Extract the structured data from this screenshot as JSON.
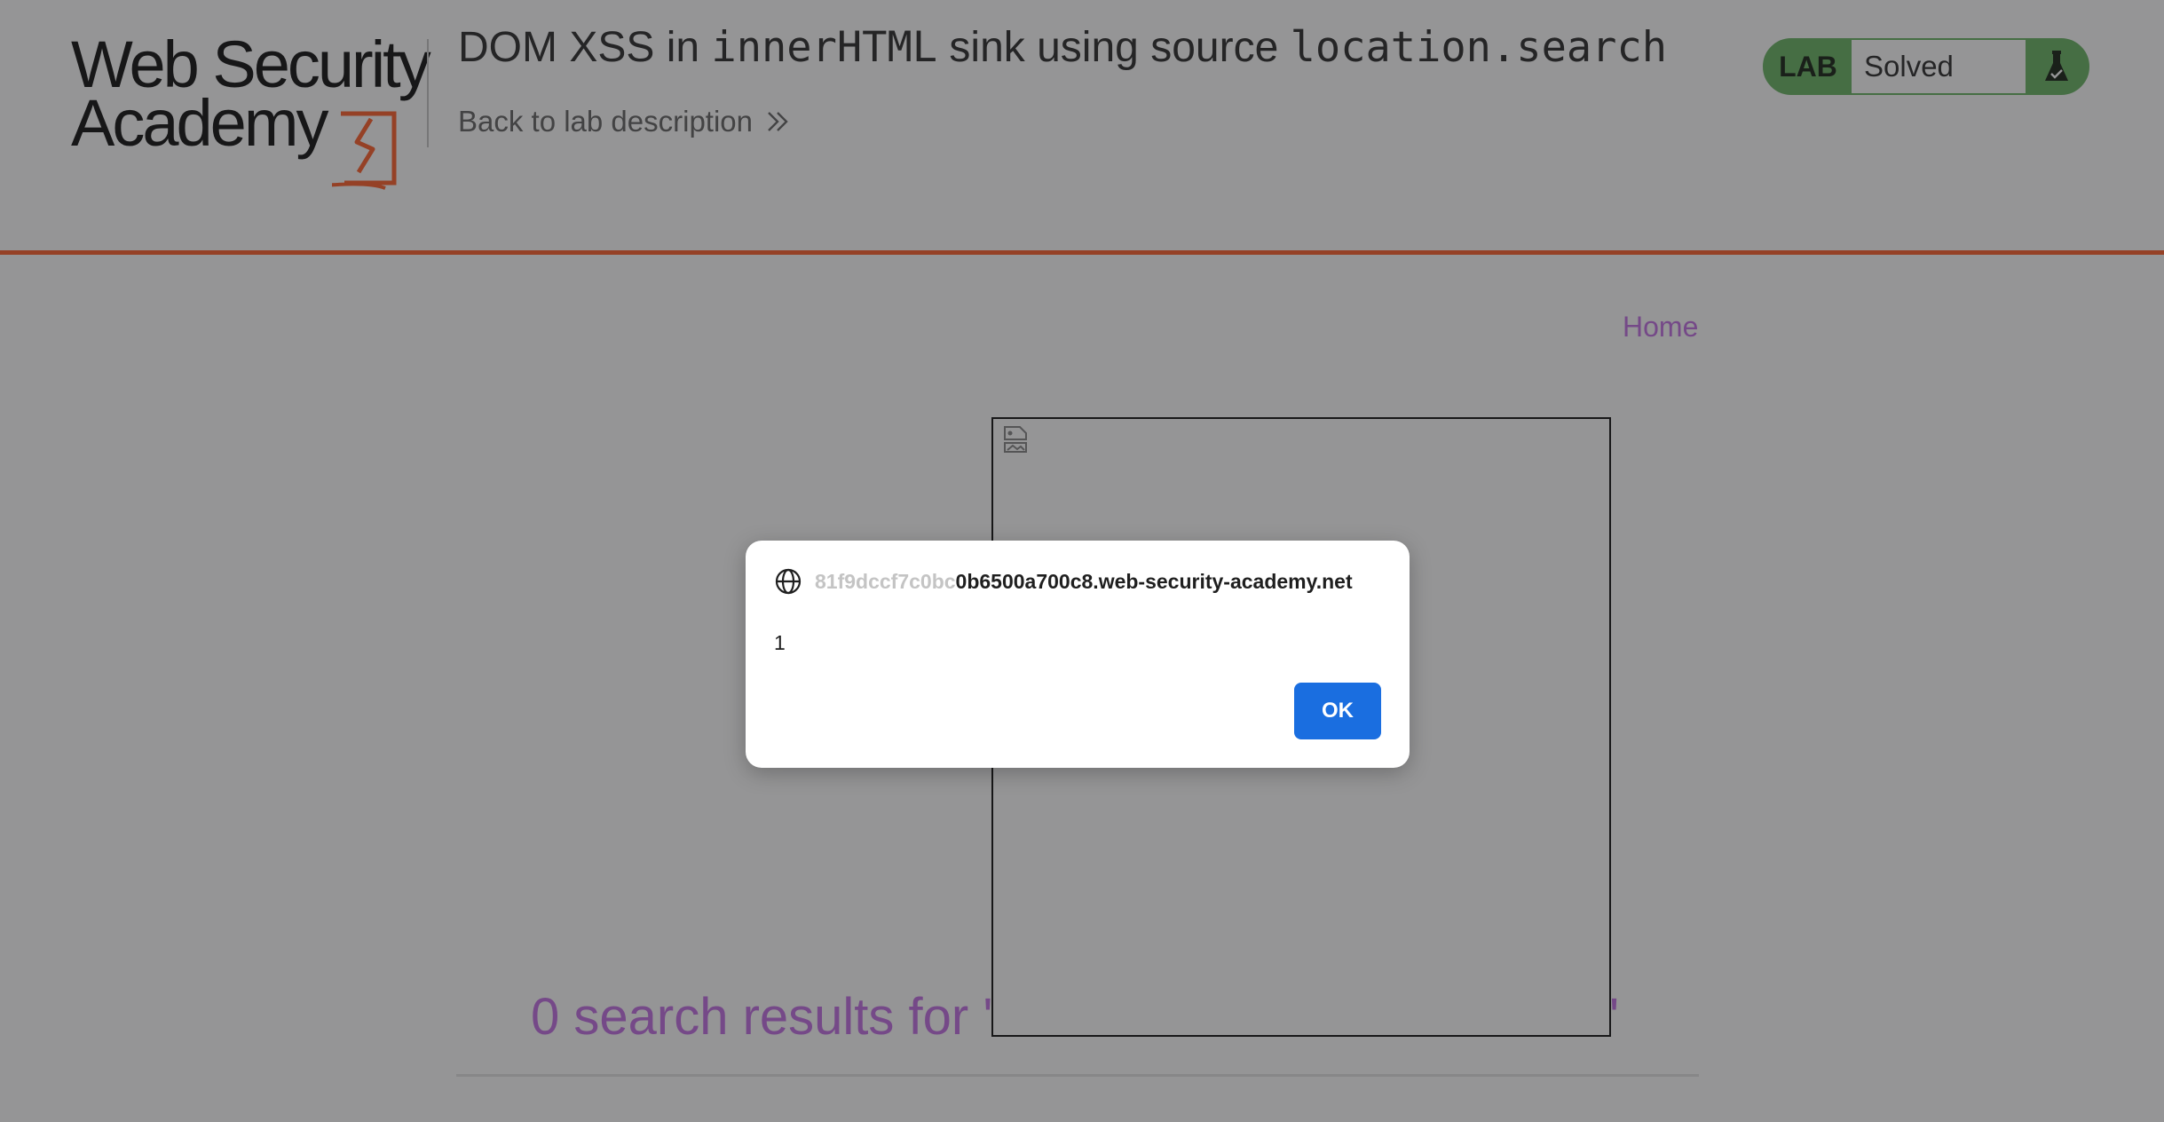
{
  "header": {
    "logo_line1": "Web Security",
    "logo_line2": "Academy",
    "title_part1": "DOM XSS in ",
    "title_code1": "innerHTML",
    "title_part2": " sink using source ",
    "title_code2": "location.search",
    "back_link": "Back to lab description",
    "status_badge": {
      "label": "LAB",
      "status": "Solved",
      "icon": "flask-icon"
    }
  },
  "nav": {
    "home": "Home"
  },
  "main": {
    "results_text": "0 search results for '",
    "results_close_quote": "'",
    "injected_image_icon": "broken-image-icon"
  },
  "dialog": {
    "origin_faded": "81f9dccf7c0bc",
    "origin_host": "0b6500a700c8.web-security-academy.net",
    "message": "1",
    "ok_label": "OK",
    "origin_icon": "globe-icon"
  },
  "colors": {
    "accent_orange": "#ff6633",
    "link_purple": "#c576e6",
    "solved_green": "#70b86a",
    "ok_blue": "#1a6ee0"
  }
}
